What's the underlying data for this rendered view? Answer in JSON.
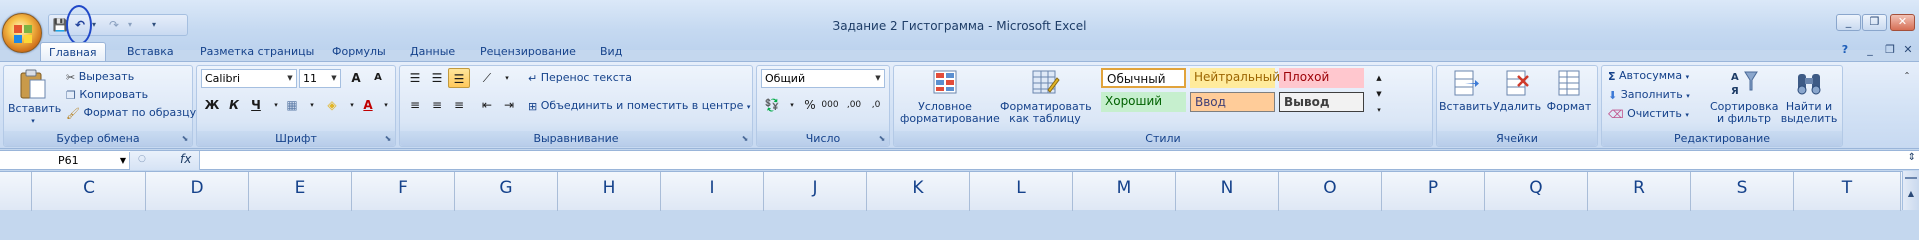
{
  "window": {
    "title": "Задание 2 Гистограмма - Microsoft Excel",
    "controls": [
      "_",
      "❐",
      "✕"
    ],
    "doc_controls": [
      "_",
      "❐",
      "✕"
    ]
  },
  "qat": {
    "save": "💾",
    "undo": "↶",
    "redo": "↷",
    "customize": "▾"
  },
  "tabs": [
    "Главная",
    "Вставка",
    "Разметка страницы",
    "Формулы",
    "Данные",
    "Рецензирование",
    "Вид"
  ],
  "help_icon": "?",
  "groups": {
    "clipboard": {
      "label": "Буфер обмена",
      "paste": "Вставить",
      "cut": "Вырезать",
      "copy": "Копировать",
      "format_painter": "Формат по образцу"
    },
    "font": {
      "label": "Шрифт",
      "font_name": "Calibri",
      "font_size": "11",
      "bold": "Ж",
      "italic": "К",
      "underline": "Ч",
      "grow": "A",
      "shrink": "A"
    },
    "alignment": {
      "label": "Выравнивание",
      "wrap": "Перенос текста",
      "merge": "Объединить и поместить в центре"
    },
    "number": {
      "label": "Число",
      "format": "Общий",
      "percent": "%",
      "thousands": "000",
      "inc_decimal": ",00",
      "dec_decimal": ",0"
    },
    "styles": {
      "label": "Стили",
      "conditional": "Условное",
      "conditional2": "форматирование",
      "as_table": "Форматировать",
      "as_table2": "как таблицу",
      "cells": [
        {
          "text": "Обычный",
          "bg": "#ffffff",
          "border": "#e1a33b"
        },
        {
          "text": "Нейтральный",
          "bg": "#ffeb9c",
          "color": "#9c6500"
        },
        {
          "text": "Плохой",
          "bg": "#ffc7ce",
          "color": "#9c0006"
        },
        {
          "text": "Хороший",
          "bg": "#c6efce",
          "color": "#006100"
        },
        {
          "text": "Ввод",
          "bg": "#ffcc99",
          "color": "#3f3f76"
        },
        {
          "text": "Вывод",
          "bg": "#f2f2f2",
          "color": "#3f3f3f"
        }
      ]
    },
    "cells": {
      "label": "Ячейки",
      "insert": "Вставить",
      "delete": "Удалить",
      "format": "Формат"
    },
    "editing": {
      "label": "Редактирование",
      "autosum": "Автосумма",
      "fill": "Заполнить",
      "clear": "Очистить",
      "sort": "Сортировка",
      "sort2": "и фильтр",
      "find": "Найти и",
      "find2": "выделить"
    }
  },
  "formula_bar": {
    "name_box": "P61",
    "fx": "fx",
    "value": ""
  },
  "columns": [
    "C",
    "D",
    "E",
    "F",
    "G",
    "H",
    "I",
    "J",
    "K",
    "L",
    "M",
    "N",
    "O",
    "P",
    "Q",
    "R",
    "S",
    "T"
  ],
  "colors": {
    "accent": "#15428b",
    "ribbon_bg": "#dae6f6",
    "selected": "#ffc95c"
  }
}
